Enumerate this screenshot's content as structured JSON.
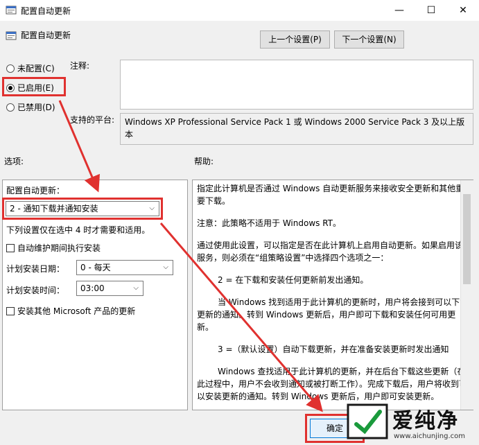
{
  "window": {
    "title": "配置自动更新",
    "minimize": "—",
    "maximize": "☐",
    "close": "✕"
  },
  "header": {
    "title": "配置自动更新",
    "prev_setting": "上一个设置(P)",
    "next_setting": "下一个设置(N)"
  },
  "state": {
    "options": [
      {
        "label": "未配置(C)",
        "checked": false
      },
      {
        "label": "已启用(E)",
        "checked": true
      },
      {
        "label": "已禁用(D)",
        "checked": false
      }
    ]
  },
  "comment_label": "注释:",
  "platform": {
    "label": "支持的平台:",
    "value": "Windows XP Professional Service Pack 1 或 Windows 2000 Service Pack 3 及以上版本"
  },
  "options_label": "选项:",
  "help_label": "帮助:",
  "options": {
    "configure_label": "配置自动更新：",
    "configure_value": "2 - 通知下载并通知安装",
    "note": "下列设置仅在选中 4 时才需要和适用。",
    "auto_maint_label": "自动维护期间执行安装",
    "schedule_day_label": "计划安装日期：",
    "schedule_day_value": "0 - 每天",
    "schedule_time_label": "计划安装时间：",
    "schedule_time_value": "03:00",
    "other_ms_label": "安装其他 Microsoft 产品的更新"
  },
  "help": {
    "p1": "指定此计算机是否通过 Windows 自动更新服务来接收安全更新和其他重要下载。",
    "p2": "注意：此策略不适用于 Windows RT。",
    "p3": "通过使用此设置，可以指定是否在此计算机上启用自动更新。如果启用该服务，则必须在“组策略设置”中选择四个选项之一：",
    "p4": "2 = 在下载和安装任何更新前发出通知。",
    "p5": "当 Windows 找到适用于此计算机的更新时，用户将会接到可以下载更新的通知。转到 Windows 更新后，用户即可下载和安装任何可用更新。",
    "p6": "3 =（默认设置）自动下载更新，并在准备安装更新时发出通知",
    "p7": "Windows 查找适用于此计算机的更新，并在后台下载这些更新（在此过程中，用户不会收到通知或被打断工作）。完成下载后，用户将收到可以安装更新的通知。转到 Windows 更新后，用户即可安装更新。"
  },
  "ok_button": "确定",
  "watermark": {
    "name": "爱纯净",
    "url": "www.aichunjing.com"
  },
  "colors": {
    "highlight": "#e0312f",
    "window_bg": "#f0f0f0"
  }
}
